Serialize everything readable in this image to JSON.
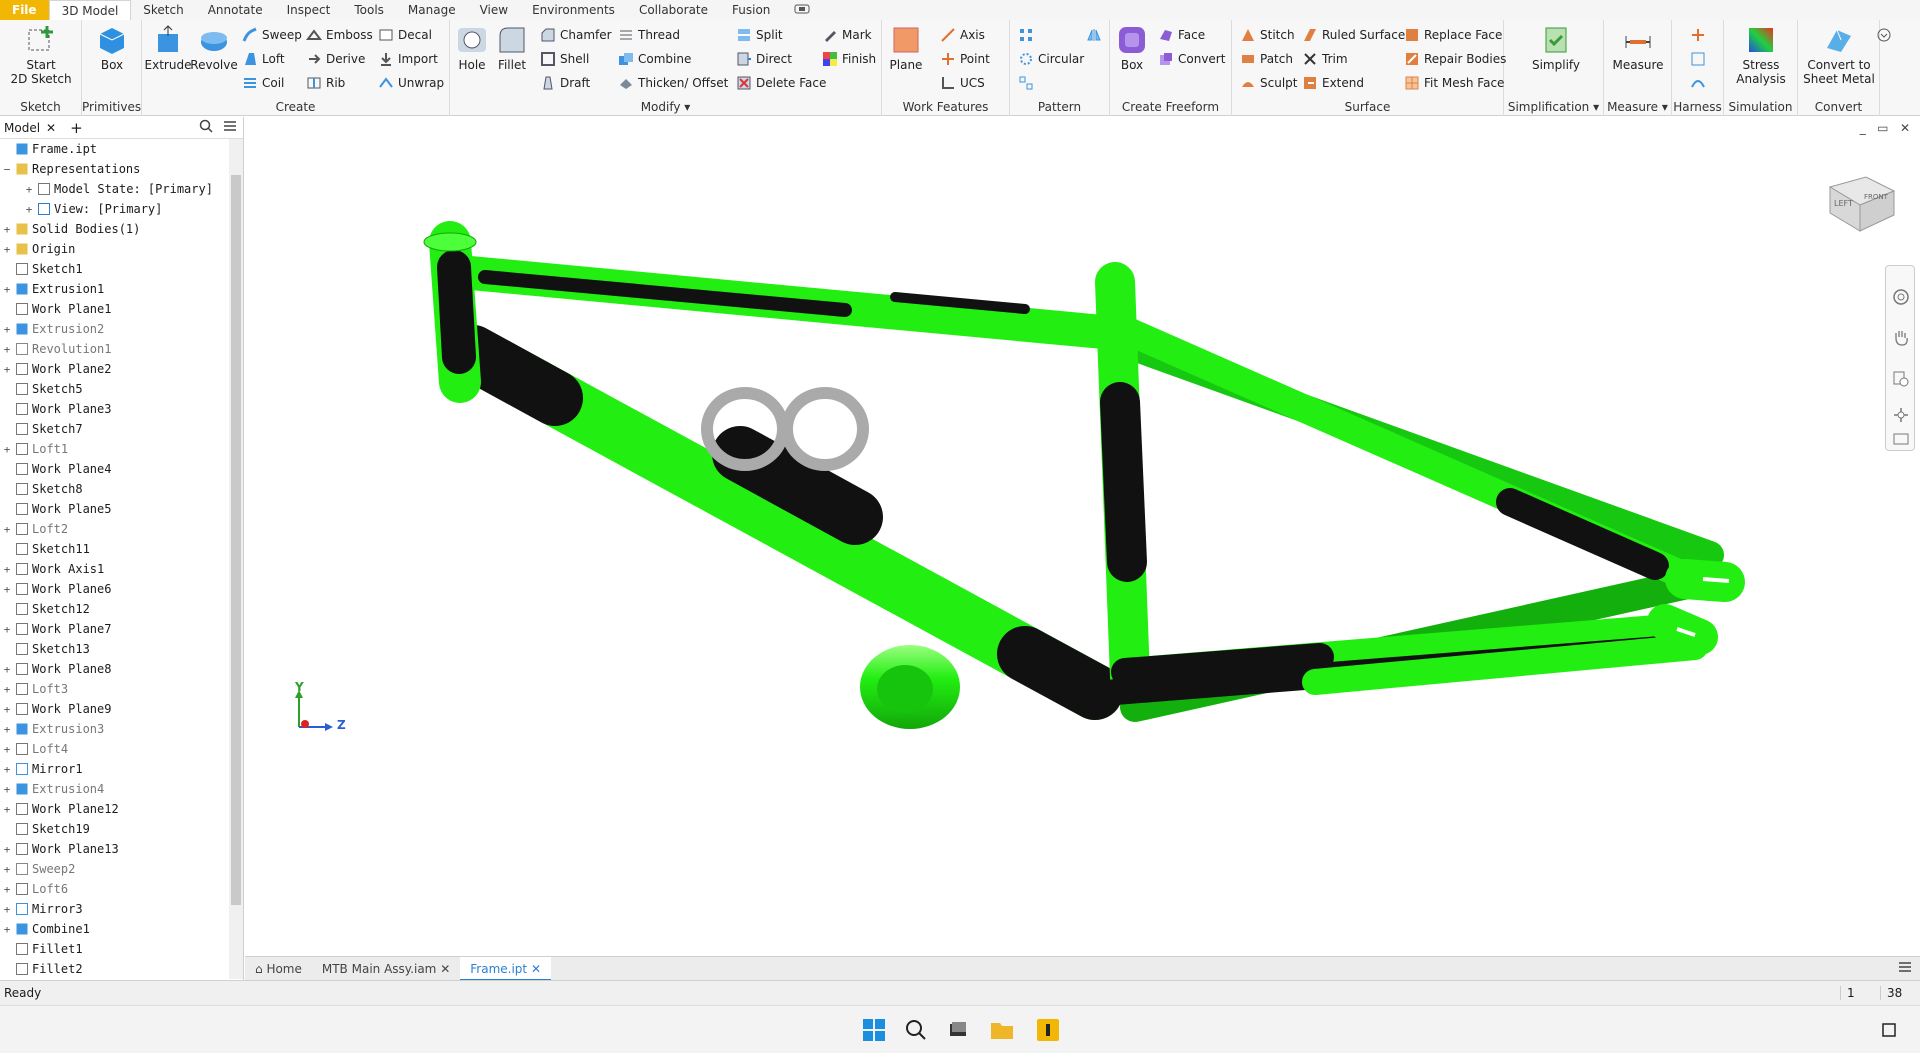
{
  "menu": {
    "tabs": [
      "File",
      "3D Model",
      "Sketch",
      "Annotate",
      "Inspect",
      "Tools",
      "Manage",
      "View",
      "Environments",
      "Collaborate",
      "Fusion"
    ],
    "active": "3D Model"
  },
  "ribbon": {
    "sketch": {
      "label": "Sketch",
      "start": "Start\n2D Sketch"
    },
    "primitives": {
      "label": "Primitives",
      "box": "Box"
    },
    "create": {
      "label": "Create",
      "extrude": "Extrude",
      "revolve": "Revolve",
      "sweep": "Sweep",
      "loft": "Loft",
      "coil": "Coil",
      "emboss": "Emboss",
      "derive": "Derive",
      "rib": "Rib",
      "decal": "Decal",
      "import": "Import",
      "unwrap": "Unwrap"
    },
    "modify": {
      "label": "Modify",
      "hole": "Hole",
      "fillet": "Fillet",
      "chamfer": "Chamfer",
      "shell": "Shell",
      "draft": "Draft",
      "thread": "Thread",
      "combine": "Combine",
      "thicken": "Thicken/ Offset",
      "split": "Split",
      "direct": "Direct",
      "delete_face": "Delete Face",
      "mark": "Mark",
      "finish": "Finish"
    },
    "work_features": {
      "label": "Work Features",
      "plane": "Plane",
      "axis": "Axis",
      "point": "Point",
      "ucs": "UCS"
    },
    "pattern": {
      "label": "Pattern",
      "circular": "Circular"
    },
    "freeform": {
      "label": "Create Freeform",
      "box": "Box",
      "face": "Face",
      "convert": "Convert"
    },
    "surface": {
      "label": "Surface",
      "stitch": "Stitch",
      "patch": "Patch",
      "sculpt": "Sculpt",
      "ruled": "Ruled Surface",
      "trim": "Trim",
      "extend": "Extend",
      "replace": "Replace Face",
      "repair": "Repair Bodies",
      "fitmesh": "Fit Mesh Face"
    },
    "simplification": {
      "label": "Simplification",
      "simplify": "Simplify"
    },
    "measure": {
      "label": "Measure",
      "measure": "Measure"
    },
    "harness": {
      "label": "Harness"
    },
    "simulation": {
      "label": "Simulation",
      "stress": "Stress\nAnalysis"
    },
    "convert": {
      "label": "Convert",
      "sheet": "Convert to\nSheet Metal"
    }
  },
  "browser": {
    "tab": "Model",
    "nodes": [
      {
        "l": "Frame.ipt",
        "e": "",
        "d": false,
        "i": "part"
      },
      {
        "l": "Representations",
        "e": "−",
        "d": false,
        "i": "folder"
      },
      {
        "l": "Model State: [Primary]",
        "e": "+",
        "d": false,
        "i": "state",
        "ind": 1
      },
      {
        "l": "View: [Primary]",
        "e": "+",
        "d": false,
        "i": "view",
        "ind": 1
      },
      {
        "l": "Solid Bodies(1)",
        "e": "+",
        "d": false,
        "i": "folder"
      },
      {
        "l": "Origin",
        "e": "+",
        "d": false,
        "i": "folder"
      },
      {
        "l": "Sketch1",
        "e": "",
        "d": false,
        "i": "sketch"
      },
      {
        "l": "Extrusion1",
        "e": "+",
        "d": false,
        "i": "extrude"
      },
      {
        "l": "Work Plane1",
        "e": "",
        "d": false,
        "i": "plane"
      },
      {
        "l": "Extrusion2",
        "e": "+",
        "d": true,
        "i": "extrude"
      },
      {
        "l": "Revolution1",
        "e": "+",
        "d": true,
        "i": "revolve"
      },
      {
        "l": "Work Plane2",
        "e": "+",
        "d": false,
        "i": "plane"
      },
      {
        "l": "Sketch5",
        "e": "",
        "d": false,
        "i": "sketch"
      },
      {
        "l": "Work Plane3",
        "e": "",
        "d": false,
        "i": "plane"
      },
      {
        "l": "Sketch7",
        "e": "",
        "d": false,
        "i": "sketch"
      },
      {
        "l": "Loft1",
        "e": "+",
        "d": true,
        "i": "loft"
      },
      {
        "l": "Work Plane4",
        "e": "",
        "d": false,
        "i": "plane"
      },
      {
        "l": "Sketch8",
        "e": "",
        "d": false,
        "i": "sketch"
      },
      {
        "l": "Work Plane5",
        "e": "",
        "d": false,
        "i": "plane"
      },
      {
        "l": "Loft2",
        "e": "+",
        "d": true,
        "i": "loft"
      },
      {
        "l": "Sketch11",
        "e": "",
        "d": false,
        "i": "sketch"
      },
      {
        "l": "Work Axis1",
        "e": "+",
        "d": false,
        "i": "axis"
      },
      {
        "l": "Work Plane6",
        "e": "+",
        "d": false,
        "i": "plane"
      },
      {
        "l": "Sketch12",
        "e": "",
        "d": false,
        "i": "sketch"
      },
      {
        "l": "Work Plane7",
        "e": "+",
        "d": false,
        "i": "plane"
      },
      {
        "l": "Sketch13",
        "e": "",
        "d": false,
        "i": "sketch"
      },
      {
        "l": "Work Plane8",
        "e": "+",
        "d": false,
        "i": "plane"
      },
      {
        "l": "Loft3",
        "e": "+",
        "d": true,
        "i": "loft"
      },
      {
        "l": "Work Plane9",
        "e": "+",
        "d": false,
        "i": "plane"
      },
      {
        "l": "Extrusion3",
        "e": "+",
        "d": true,
        "i": "extrude"
      },
      {
        "l": "Loft4",
        "e": "+",
        "d": true,
        "i": "loft"
      },
      {
        "l": "Mirror1",
        "e": "+",
        "d": false,
        "i": "mirror"
      },
      {
        "l": "Extrusion4",
        "e": "+",
        "d": true,
        "i": "extrude"
      },
      {
        "l": "Work Plane12",
        "e": "+",
        "d": false,
        "i": "plane"
      },
      {
        "l": "Sketch19",
        "e": "",
        "d": false,
        "i": "sketch"
      },
      {
        "l": "Work Plane13",
        "e": "+",
        "d": false,
        "i": "plane"
      },
      {
        "l": "Sweep2",
        "e": "+",
        "d": true,
        "i": "sweep"
      },
      {
        "l": "Loft6",
        "e": "+",
        "d": true,
        "i": "loft"
      },
      {
        "l": "Mirror3",
        "e": "+",
        "d": false,
        "i": "mirror"
      },
      {
        "l": "Combine1",
        "e": "+",
        "d": false,
        "i": "combine"
      },
      {
        "l": "Fillet1",
        "e": "",
        "d": false,
        "i": "fillet"
      },
      {
        "l": "Fillet2",
        "e": "",
        "d": false,
        "i": "fillet"
      }
    ]
  },
  "doc_tabs": {
    "home": "Home",
    "t1": "MTB Main Assy.iam",
    "t2": "Frame.ipt"
  },
  "viewcube": {
    "left": "LEFT",
    "front": "FRONT"
  },
  "triad": {
    "y": "Y",
    "z": "Z"
  },
  "status": {
    "text": "Ready",
    "n1": "1",
    "n2": "38"
  },
  "colors": {
    "frame": "#22ee11",
    "stripe": "#111111",
    "accent": "#2a7fd4"
  }
}
